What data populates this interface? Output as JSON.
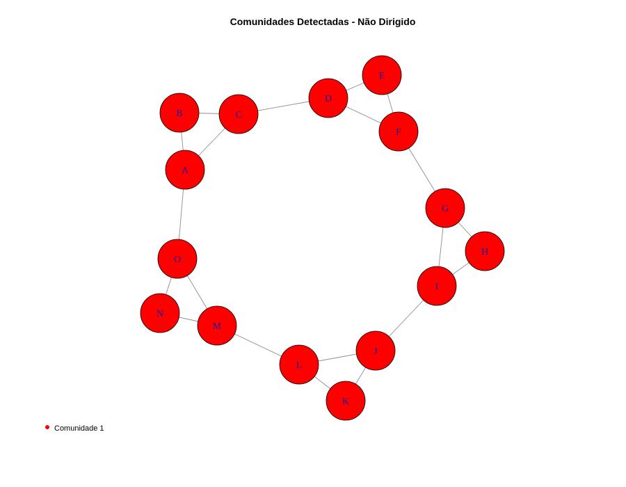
{
  "title": "Comunidades Detectadas - Não Dirigido",
  "colors": {
    "node_fill": "#ff0000",
    "node_stroke": "#000000",
    "label": "#1a1aa0",
    "edge": "#8c8c8c"
  },
  "nodes": [
    "A",
    "B",
    "C",
    "D",
    "E",
    "F",
    "G",
    "H",
    "I",
    "J",
    "K",
    "L",
    "M",
    "N",
    "O"
  ],
  "edges": [
    [
      "A",
      "B"
    ],
    [
      "A",
      "C"
    ],
    [
      "B",
      "C"
    ],
    [
      "C",
      "D"
    ],
    [
      "D",
      "E"
    ],
    [
      "D",
      "F"
    ],
    [
      "E",
      "F"
    ],
    [
      "F",
      "G"
    ],
    [
      "G",
      "H"
    ],
    [
      "G",
      "I"
    ],
    [
      "H",
      "I"
    ],
    [
      "I",
      "J"
    ],
    [
      "J",
      "K"
    ],
    [
      "J",
      "L"
    ],
    [
      "K",
      "L"
    ],
    [
      "L",
      "M"
    ],
    [
      "M",
      "N"
    ],
    [
      "M",
      "O"
    ],
    [
      "N",
      "O"
    ],
    [
      "O",
      "A"
    ]
  ],
  "legend": {
    "items": [
      {
        "label": "Comunidade 1",
        "color": "#ff0000"
      }
    ]
  }
}
